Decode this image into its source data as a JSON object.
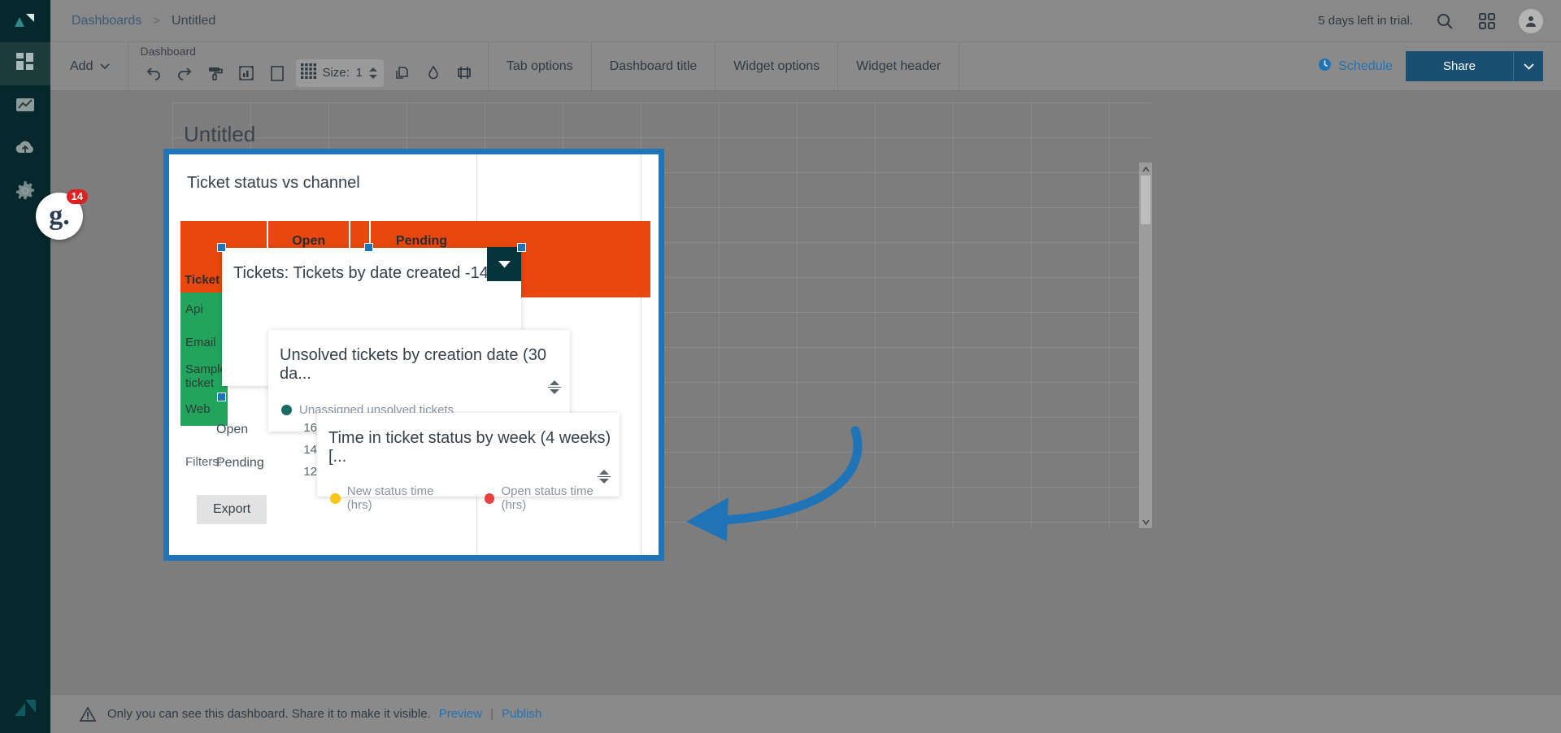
{
  "app": {
    "breadcrumb": {
      "root": "Dashboards",
      "separator": ">",
      "current": "Untitled"
    },
    "trial_notice": "5 days left in trial."
  },
  "ribbon": {
    "add_label": "Add",
    "group_label": "Dashboard",
    "size_label": "Size:",
    "size_value": "1",
    "tabs": [
      "Tab options",
      "Dashboard title",
      "Widget options",
      "Widget header"
    ],
    "schedule_label": "Schedule",
    "share_label": "Share",
    "tools": [
      "undo-icon",
      "redo-icon",
      "paint-roller-icon",
      "chart-frame-icon",
      "rectangle-icon",
      "grid-icon",
      "duplicate-icon",
      "droplet-icon",
      "layout-icon"
    ]
  },
  "canvas": {
    "title": "Untitled"
  },
  "widget_table": {
    "title": "Ticket status vs channel",
    "column_headers": [
      "",
      "Open",
      "",
      "Pending",
      ""
    ],
    "row_header_label": "Ticket channel",
    "row_labels": [
      "Api",
      "Email",
      "Sample ticket",
      "Web"
    ],
    "status_rows": [
      "Open",
      "Pending"
    ],
    "sub_label": "Ticket status",
    "filters_label": "Filters:",
    "export_label": "Export"
  },
  "cards": [
    {
      "title": "Tickets: Tickets by date  created -14...",
      "caret": "chevron-down-icon"
    },
    {
      "title": "Unsolved tickets by creation date (30 da...",
      "legend": [
        {
          "label": "Unassigned unsolved tickets",
          "color": "#1a6b63"
        }
      ]
    },
    {
      "title": "Time in ticket status by week (4 weeks) [...",
      "legend": [
        {
          "label": "New status time (hrs)",
          "color": "#f5c518"
        },
        {
          "label": "Open status time (hrs)",
          "color": "#e8433f"
        }
      ],
      "y_axis_ticks": [
        "16",
        "14",
        "12"
      ]
    }
  ],
  "status_bar": {
    "message": "Only you can see this dashboard. Share it to make it visible.",
    "preview_link": "Preview",
    "separator": "|",
    "publish_link": "Publish"
  },
  "sidebar": {
    "items": [
      "dashboard-grid-icon",
      "chart-icon",
      "cloud-upload-icon",
      "gear-icon"
    ],
    "badge_count": "14",
    "badge_letter": "g."
  },
  "colors": {
    "accent": "#1f73b7",
    "header_red": "#e8470d",
    "row_green": "#22a45d",
    "rail_dark": "#04282c",
    "share_blue": "#1b4f72"
  }
}
